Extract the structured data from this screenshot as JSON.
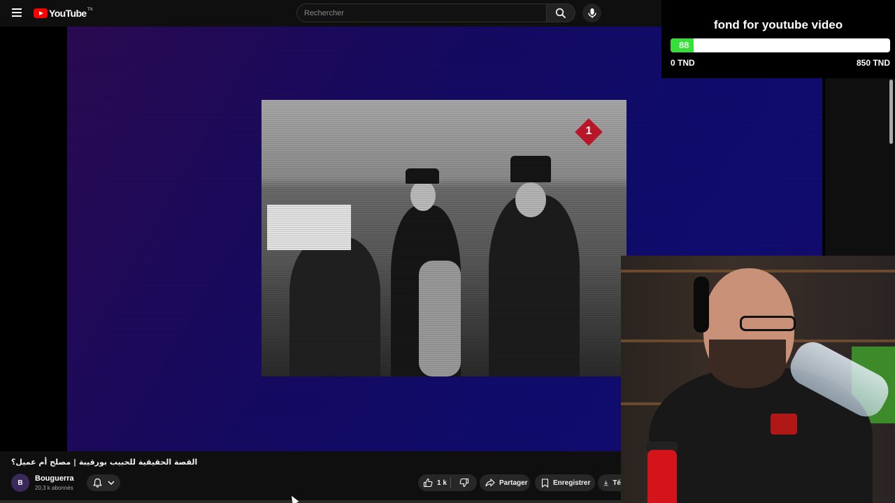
{
  "header": {
    "logo_text": "YouTube",
    "logo_tm": "TN",
    "search_placeholder": "Rechercher",
    "icons": [
      "menu-icon",
      "search-icon",
      "microphone-icon"
    ]
  },
  "donation": {
    "title": "fond for youtube video",
    "current": "88",
    "min": "0 TND",
    "max": "850 TND",
    "fill_fraction": 0.104,
    "fill_color": "#36e03a"
  },
  "video": {
    "title": "القصة الحقيقية للحبيب بورقيبة | مصلح أم عميل؟",
    "channel": "Bouguerra",
    "subscribers": "20,3 k abonnés"
  },
  "actions": {
    "likes": "1 k",
    "share": "Partager",
    "save": "Enregistrer",
    "download": "Té"
  },
  "colors": {
    "brand_red": "#ff0000",
    "background": "#0f0f0f",
    "pill": "#272727"
  }
}
